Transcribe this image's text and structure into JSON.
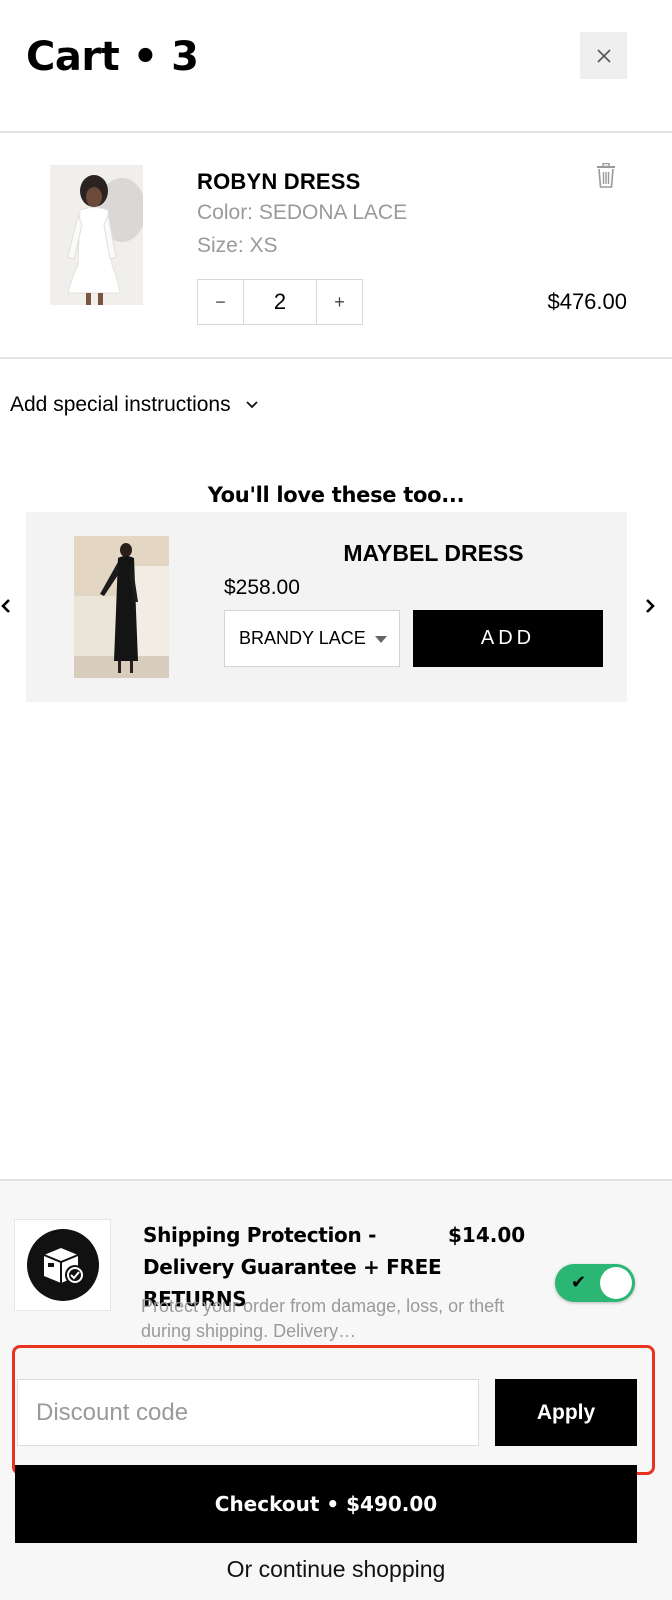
{
  "header": {
    "title": "Cart • 3",
    "close_icon": "close-icon"
  },
  "cart_item": {
    "name": "ROBYN DRESS",
    "color": "Color: SEDONA LACE",
    "size": "Size: XS",
    "quantity": "2",
    "price": "$476.00",
    "minus_label": "−",
    "plus_label": "+"
  },
  "instructions": {
    "label": "Add special instructions"
  },
  "upsell": {
    "title": "You'll love these too...",
    "product_name": "MAYBEL DRESS",
    "price": "$258.00",
    "variant": "BRANDY LACE",
    "add_label": "ADD"
  },
  "footer": {
    "protection_title": "Shipping Protection - Delivery Guarantee + FREE RETURNS",
    "protection_price": "$14.00",
    "protection_desc": "Protect your order from damage, loss, or theft during shipping. Delivery…",
    "protection_enabled": true,
    "discount_placeholder": "Discount code",
    "apply_label": "Apply",
    "checkout_label": "Checkout • $490.00",
    "continue_label": "Or continue shopping"
  },
  "colors": {
    "toggle_on": "#2bb673",
    "highlight": "#e8321f",
    "primary_button": "#000000"
  }
}
